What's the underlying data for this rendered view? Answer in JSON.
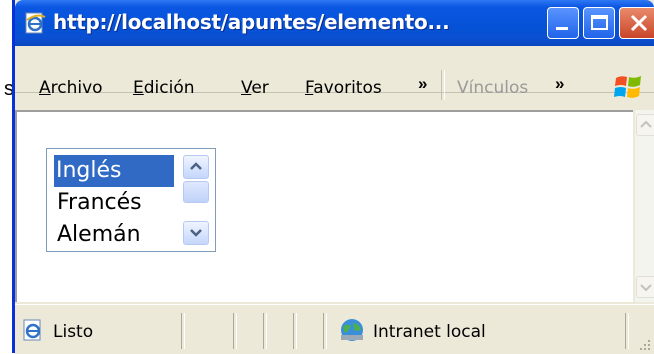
{
  "window": {
    "title": "http://localhost/apuntes/elemento..."
  },
  "background_text": "s",
  "menu": {
    "items": [
      {
        "accel": "A",
        "rest": "rchivo"
      },
      {
        "accel": "E",
        "rest": "dición"
      },
      {
        "accel": "V",
        "rest": "er"
      },
      {
        "accel": "F",
        "rest": "avoritos"
      }
    ],
    "overflow": "»",
    "links_label": "Vínculos",
    "links_overflow": "»"
  },
  "listbox": {
    "options": [
      "Inglés",
      "Francés",
      "Alemán"
    ],
    "selected": "Inglés"
  },
  "statusbar": {
    "status": "Listo",
    "zone": "Intranet local"
  },
  "colors": {
    "titlebar": "#0552d6",
    "selection": "#316ac5",
    "chrome": "#ece9d8"
  }
}
